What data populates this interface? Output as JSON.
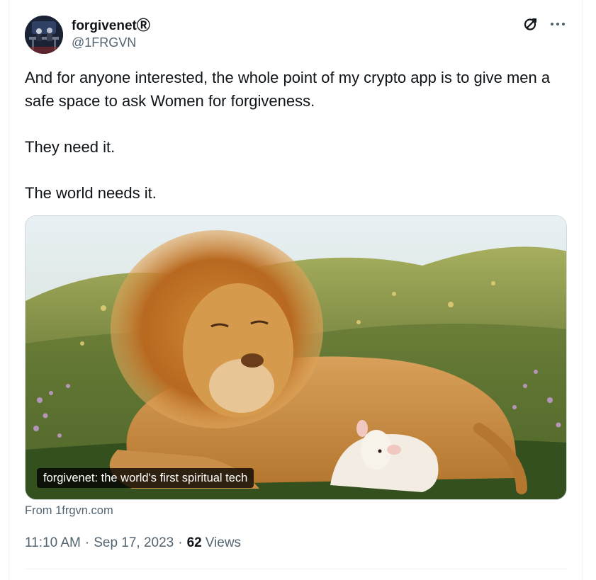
{
  "author": {
    "display_name": "forgivenetⓇ",
    "handle": "@1FRGVN"
  },
  "header": {
    "grok_icon": "grok-icon",
    "more_icon": "more-icon"
  },
  "tweet": {
    "paragraphs": [
      "And for anyone interested, the whole point of my crypto app is to give men a safe space to ask Women for forgiveness.",
      "They need it.",
      "The world needs it."
    ]
  },
  "card": {
    "title": "forgivenet: the world's first spiritual tech",
    "source_prefix": "From ",
    "source_domain": "1frgvn.com"
  },
  "meta": {
    "time": "11:10 AM",
    "separator": "·",
    "date": "Sep 17, 2023",
    "views_count": "62",
    "views_label": "Views"
  },
  "colors": {
    "text_primary": "#0f1419",
    "text_secondary": "#536471",
    "border": "#cfd9de"
  }
}
